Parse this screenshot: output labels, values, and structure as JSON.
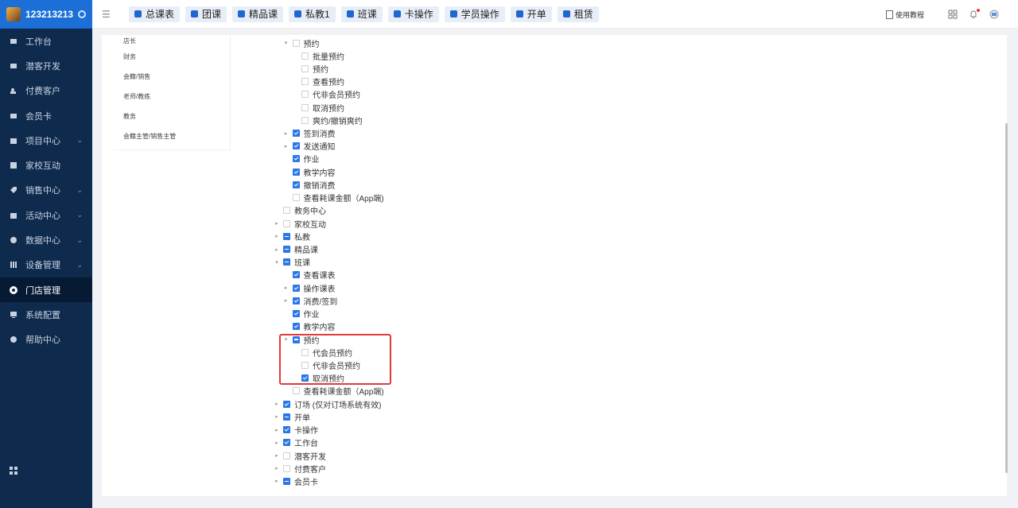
{
  "brand": {
    "name": "123213213"
  },
  "sidebar": {
    "items": [
      {
        "label": "工作台",
        "icon": "image-icon",
        "chevron": false,
        "active": false
      },
      {
        "label": "潜客开发",
        "icon": "id-card-icon",
        "chevron": false,
        "active": false
      },
      {
        "label": "付费客户",
        "icon": "users-icon",
        "chevron": false,
        "active": false
      },
      {
        "label": "会员卡",
        "icon": "card-icon",
        "chevron": false,
        "active": false
      },
      {
        "label": "项目中心",
        "icon": "folder-icon",
        "chevron": true,
        "active": false
      },
      {
        "label": "家校互动",
        "icon": "contact-icon",
        "chevron": false,
        "active": false
      },
      {
        "label": "销售中心",
        "icon": "tag-icon",
        "chevron": true,
        "active": false
      },
      {
        "label": "活动中心",
        "icon": "calendar-icon",
        "chevron": true,
        "active": false
      },
      {
        "label": "数据中心",
        "icon": "pie-chart-icon",
        "chevron": true,
        "active": false
      },
      {
        "label": "设备管理",
        "icon": "columns-icon",
        "chevron": true,
        "active": false
      },
      {
        "label": "门店管理",
        "icon": "store-icon",
        "chevron": false,
        "active": true
      },
      {
        "label": "系统配置",
        "icon": "monitor-icon",
        "chevron": false,
        "active": false
      },
      {
        "label": "帮助中心",
        "icon": "help-icon",
        "chevron": false,
        "active": false
      }
    ]
  },
  "topbar": {
    "tabs": [
      {
        "label": "总课表",
        "icon": "calendar-icon"
      },
      {
        "label": "团课",
        "icon": "book-icon"
      },
      {
        "label": "精品课",
        "icon": "star-book-icon"
      },
      {
        "label": "私教1",
        "icon": "people-icon"
      },
      {
        "label": "班课",
        "icon": "class-icon"
      },
      {
        "label": "卡操作",
        "icon": "card-icon"
      },
      {
        "label": "学员操作",
        "icon": "student-icon"
      },
      {
        "label": "开单",
        "icon": "order-icon"
      },
      {
        "label": "租赁",
        "icon": "lease-icon"
      }
    ],
    "tutorial_label": "使用教程"
  },
  "roles": [
    "店长",
    "财务",
    "会籍/销售",
    "老师/教练",
    "教务",
    "会籍主管/销售主管"
  ],
  "tree": [
    {
      "label": "预约",
      "indent": 1,
      "arrow": "down",
      "state": "unchecked"
    },
    {
      "label": "批量预约",
      "indent": 2,
      "arrow": "none",
      "state": "unchecked"
    },
    {
      "label": "预约",
      "indent": 2,
      "arrow": "none",
      "state": "unchecked"
    },
    {
      "label": "查看预约",
      "indent": 2,
      "arrow": "none",
      "state": "unchecked"
    },
    {
      "label": "代非会员预约",
      "indent": 2,
      "arrow": "none",
      "state": "unchecked"
    },
    {
      "label": "取消预约",
      "indent": 2,
      "arrow": "none",
      "state": "unchecked"
    },
    {
      "label": "爽约/撤销爽约",
      "indent": 2,
      "arrow": "none",
      "state": "unchecked"
    },
    {
      "label": "签到消费",
      "indent": 1,
      "arrow": "right",
      "state": "checked"
    },
    {
      "label": "发送通知",
      "indent": 1,
      "arrow": "right",
      "state": "checked"
    },
    {
      "label": "作业",
      "indent": 1,
      "arrow": "none",
      "state": "checked"
    },
    {
      "label": "教学内容",
      "indent": 1,
      "arrow": "none",
      "state": "checked"
    },
    {
      "label": "撤销消费",
      "indent": 1,
      "arrow": "none",
      "state": "checked"
    },
    {
      "label": "查看耗课金额（App端)",
      "indent": 1,
      "arrow": "none",
      "state": "unchecked"
    },
    {
      "label": "教务中心",
      "indent": 0,
      "arrow": "none",
      "state": "unchecked"
    },
    {
      "label": "家校互动",
      "indent": 0,
      "arrow": "right",
      "state": "unchecked"
    },
    {
      "label": "私教",
      "indent": 0,
      "arrow": "right",
      "state": "partial"
    },
    {
      "label": "精品课",
      "indent": 0,
      "arrow": "right",
      "state": "partial"
    },
    {
      "label": "班课",
      "indent": 0,
      "arrow": "down",
      "state": "partial"
    },
    {
      "label": "查看课表",
      "indent": 1,
      "arrow": "none",
      "state": "checked"
    },
    {
      "label": "操作课表",
      "indent": 1,
      "arrow": "right",
      "state": "checked"
    },
    {
      "label": "消费/签到",
      "indent": 1,
      "arrow": "right",
      "state": "checked"
    },
    {
      "label": "作业",
      "indent": 1,
      "arrow": "none",
      "state": "checked"
    },
    {
      "label": "教学内容",
      "indent": 1,
      "arrow": "none",
      "state": "checked"
    },
    {
      "label": "预约",
      "indent": 1,
      "arrow": "down",
      "state": "partial"
    },
    {
      "label": "代会员预约",
      "indent": 2,
      "arrow": "none",
      "state": "unchecked"
    },
    {
      "label": "代非会员预约",
      "indent": 2,
      "arrow": "none",
      "state": "unchecked"
    },
    {
      "label": "取消预约",
      "indent": 2,
      "arrow": "none",
      "state": "checked"
    },
    {
      "label": "查看耗课金额（App端)",
      "indent": 1,
      "arrow": "none",
      "state": "unchecked"
    },
    {
      "label": "订场 (仅对订场系统有效)",
      "indent": 0,
      "arrow": "right",
      "state": "checked"
    },
    {
      "label": "开单",
      "indent": 0,
      "arrow": "right",
      "state": "partial"
    },
    {
      "label": "卡操作",
      "indent": 0,
      "arrow": "right",
      "state": "checked"
    },
    {
      "label": "工作台",
      "indent": 0,
      "arrow": "right",
      "state": "checked"
    },
    {
      "label": "潜客开发",
      "indent": 0,
      "arrow": "right",
      "state": "unchecked"
    },
    {
      "label": "付费客户",
      "indent": 0,
      "arrow": "right",
      "state": "unchecked"
    },
    {
      "label": "会员卡",
      "indent": 0,
      "arrow": "right",
      "state": "partial"
    }
  ],
  "colors": {
    "sidebar_bg": "#0e2a4d",
    "brand_bg": "#1c6fd6",
    "accent": "#2a77e6",
    "highlight": "#e23a3a"
  }
}
